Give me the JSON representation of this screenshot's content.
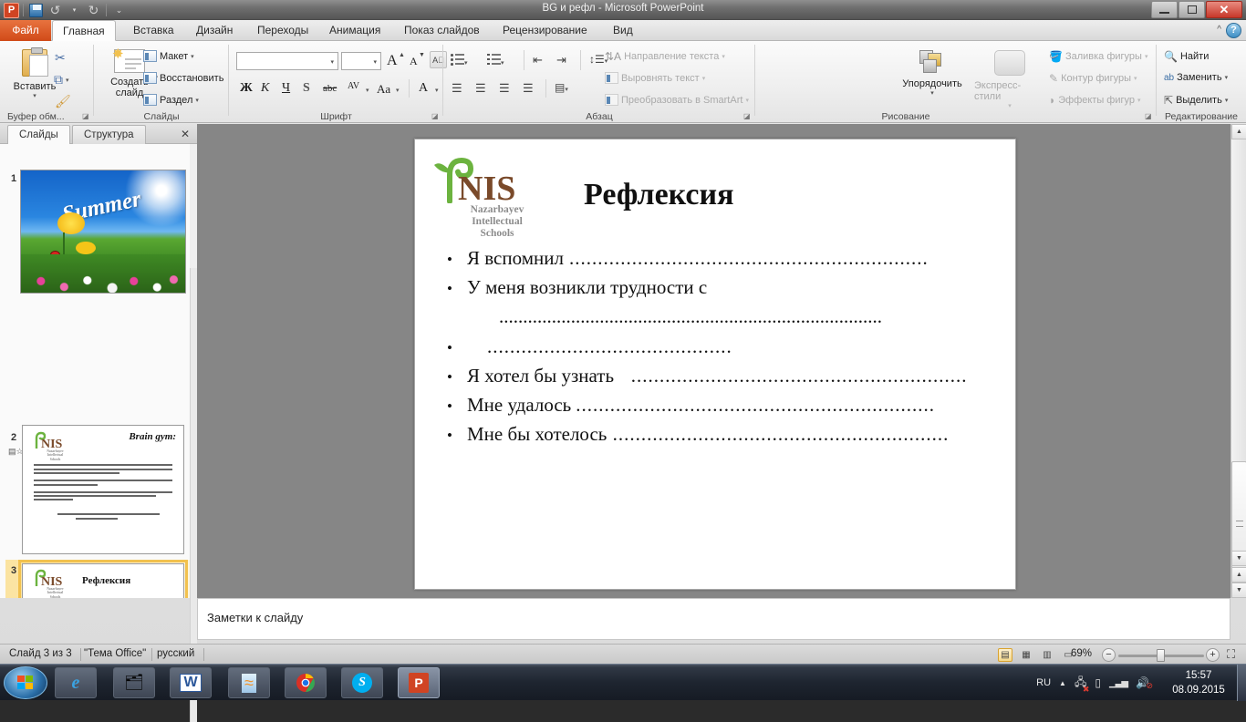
{
  "window": {
    "title": "BG и рефл  -  Microsoft PowerPoint",
    "minimize_label": "—",
    "maximize_label": "❐",
    "close_label": "✕",
    "help_label": "?",
    "collapse_ribbon_label": "^"
  },
  "quick_access": {
    "app_logo": "P",
    "items": [
      {
        "name": "save-icon",
        "label": "💾"
      },
      {
        "name": "undo-icon",
        "label": "↺"
      },
      {
        "name": "redo-icon",
        "label": "↻"
      },
      {
        "name": "customize-qat-icon",
        "label": "⌄"
      }
    ]
  },
  "ribbon": {
    "tabs": [
      {
        "label": "Файл",
        "active": false,
        "file": true
      },
      {
        "label": "Главная",
        "active": true
      },
      {
        "label": "Вставка",
        "active": false
      },
      {
        "label": "Дизайн",
        "active": false
      },
      {
        "label": "Переходы",
        "active": false
      },
      {
        "label": "Анимация",
        "active": false
      },
      {
        "label": "Показ слайдов",
        "active": false
      },
      {
        "label": "Рецензирование",
        "active": false
      },
      {
        "label": "Вид",
        "active": false
      }
    ],
    "groups": {
      "clipboard": {
        "label": "Буфер обм...",
        "paste_label": "Вставить",
        "cut_label": "✂",
        "copy_label": "⧉",
        "format_painter_label": "🖌"
      },
      "slides": {
        "label": "Слайды",
        "new_slide_label": "Создать слайд",
        "layout_label": "Макет",
        "reset_label": "Восстановить",
        "section_label": "Раздел"
      },
      "font": {
        "label": "Шрифт",
        "font_name_value": "",
        "font_size_value": "",
        "grow_label": "A",
        "shrink_label": "A",
        "clear_format_label": "A",
        "bold_label": "Ж",
        "italic_label": "К",
        "underline_label": "Ч",
        "shadow_label": "S",
        "strike_label": "abc",
        "spacing_label": "AV",
        "case_label": "Aa",
        "color_label": "A"
      },
      "paragraph": {
        "label": "Абзац",
        "text_direction_label": "Направление текста",
        "align_text_label": "Выровнять текст",
        "smartart_label": "Преобразовать в SmartArt"
      },
      "drawing": {
        "label": "Рисование",
        "arrange_label": "Упорядочить",
        "quick_styles_label": "Экспресс-стили",
        "shape_fill_label": "Заливка фигуры",
        "shape_outline_label": "Контур фигуры",
        "shape_effects_label": "Эффекты фигур"
      },
      "editing": {
        "label": "Редактирование",
        "find_label": "Найти",
        "replace_label": "Заменить",
        "select_label": "Выделить"
      }
    }
  },
  "left_pane": {
    "tabs": [
      {
        "label": "Слайды",
        "active": true
      },
      {
        "label": "Структура",
        "active": false
      }
    ],
    "close_label": "✕",
    "thumbnails": [
      {
        "number": "1",
        "selected": false,
        "kind": "summer-photo"
      },
      {
        "number": "2",
        "selected": false,
        "kind": "brain-gym",
        "title": "Brain gym:"
      },
      {
        "number": "3",
        "selected": true,
        "kind": "reflection",
        "title": "Рефлексия"
      }
    ]
  },
  "slide": {
    "title": "Рефлексия",
    "logo": {
      "name_text": "NIS",
      "sub_line1": "Nazarbayev",
      "sub_line2": "Intellectual",
      "sub_line3": "Schools",
      "leaf_color": "#6cb33f",
      "text_color": "#7a4a2a"
    },
    "bullets": [
      {
        "bullet": "•",
        "text": "Я вспомнил",
        "dots": "..............................................................."
      },
      {
        "bullet": "•",
        "text": "У меня возникли трудности с",
        "dots": ""
      },
      {
        "bullet": "",
        "text": "",
        "dots": "................................................................................"
      },
      {
        "bullet": "•",
        "text": "",
        "dots": "..........................................."
      },
      {
        "bullet": "•",
        "text": "Я хотел бы узнать",
        "dots": "   ..........................................................."
      },
      {
        "bullet": "•",
        "text": "Мне удалось",
        "dots": "..............................................................."
      },
      {
        "bullet": "•",
        "text": "Мне бы хотелось",
        "dots": " ..........................................................."
      }
    ]
  },
  "notes": {
    "placeholder_text": "Заметки к слайду"
  },
  "status_bar": {
    "slide_counter": "Слайд 3 из 3",
    "theme": "\"Тема Office\"",
    "language": "русский",
    "zoom_value": "69%",
    "zoom_out_label": "−",
    "zoom_in_label": "+",
    "fit_label": "⛶",
    "view_buttons": [
      {
        "name": "view-normal",
        "label": "▤",
        "active": true
      },
      {
        "name": "view-sorter",
        "label": "▦",
        "active": false
      },
      {
        "name": "view-reading",
        "label": "▥",
        "active": false
      },
      {
        "name": "view-slideshow",
        "label": "▭",
        "active": false
      }
    ]
  },
  "taskbar": {
    "start_label": "",
    "buttons": [
      {
        "name": "taskbar-internet-explorer",
        "label": "e",
        "active": false
      },
      {
        "name": "taskbar-explorer",
        "label": "📁",
        "active": false
      },
      {
        "name": "taskbar-word",
        "label": "W",
        "active": false
      },
      {
        "name": "taskbar-smartnotebook",
        "label": "≈",
        "active": false
      },
      {
        "name": "taskbar-chrome",
        "label": "◉",
        "active": false
      },
      {
        "name": "taskbar-skype",
        "label": "S",
        "active": false
      },
      {
        "name": "taskbar-powerpoint",
        "label": "P",
        "active": true
      }
    ],
    "tray": {
      "language": "RU",
      "show_hidden_label": "▲",
      "network_label": "🖧",
      "battery_label": "🔋",
      "signal_label": "▂▄▆",
      "volume_label": "🔊",
      "time": "15:57",
      "date": "08.09.2015"
    }
  }
}
